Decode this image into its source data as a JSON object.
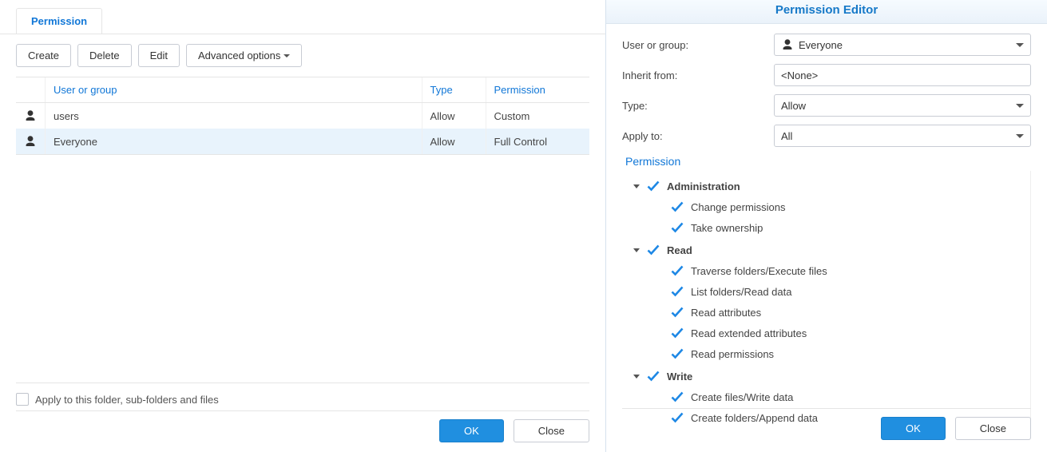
{
  "left": {
    "tab_label": "Permission",
    "toolbar": {
      "create_label": "Create",
      "delete_label": "Delete",
      "edit_label": "Edit",
      "advanced_label": "Advanced options"
    },
    "table": {
      "col_user": "User or group",
      "col_type": "Type",
      "col_permission": "Permission",
      "rows": [
        {
          "user": "users",
          "type": "Allow",
          "permission": "Custom",
          "selected": false
        },
        {
          "user": "Everyone",
          "type": "Allow",
          "permission": "Full Control",
          "selected": true
        }
      ]
    },
    "apply_label": "Apply to this folder, sub-folders and files",
    "ok_label": "OK",
    "close_label": "Close"
  },
  "right": {
    "title": "Permission Editor",
    "form": {
      "user_label": "User or group:",
      "user_value": "Everyone",
      "inherit_label": "Inherit from:",
      "inherit_value": "<None>",
      "type_label": "Type:",
      "type_value": "Allow",
      "apply_label": "Apply to:",
      "apply_value": "All"
    },
    "perm_section_label": "Permission",
    "tree": [
      {
        "label": "Administration",
        "items": [
          {
            "label": "Change permissions"
          },
          {
            "label": "Take ownership"
          }
        ]
      },
      {
        "label": "Read",
        "items": [
          {
            "label": "Traverse folders/Execute files"
          },
          {
            "label": "List folders/Read data"
          },
          {
            "label": "Read attributes"
          },
          {
            "label": "Read extended attributes"
          },
          {
            "label": "Read permissions"
          }
        ]
      },
      {
        "label": "Write",
        "items": [
          {
            "label": "Create files/Write data"
          },
          {
            "label": "Create folders/Append data"
          }
        ]
      }
    ],
    "ok_label": "OK",
    "close_label": "Close"
  }
}
